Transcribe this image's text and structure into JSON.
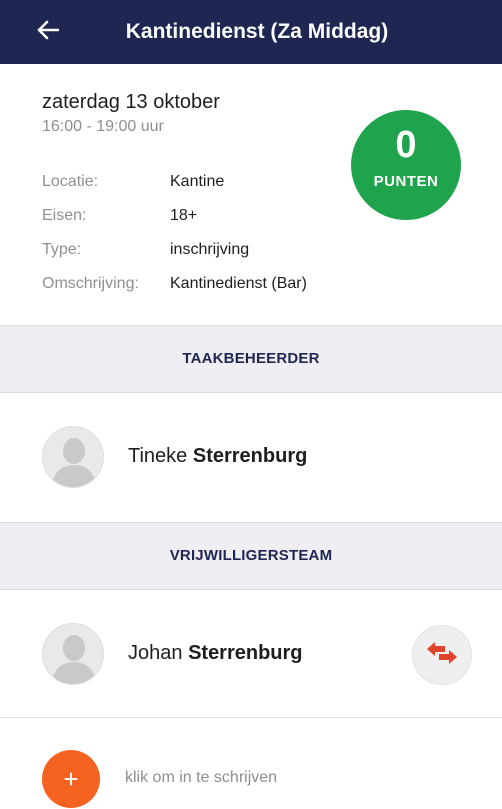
{
  "header": {
    "title": "Kantinedienst (Za Middag)",
    "back_icon": "arrow-left-icon"
  },
  "task": {
    "date": "zaterdag 13 oktober",
    "time": "16:00 - 19:00 uur",
    "details": [
      {
        "label": "Locatie:",
        "value": "Kantine"
      },
      {
        "label": "Eisen:",
        "value": "18+"
      },
      {
        "label": "Type:",
        "value": "inschrijving"
      },
      {
        "label": "Omschrijving:",
        "value": "Kantinedienst (Bar)"
      }
    ],
    "points": {
      "value": "0",
      "label": "PUNTEN",
      "color": "#1fa44d"
    }
  },
  "sections": {
    "manager": {
      "title": "TAAKBEHEERDER",
      "person": {
        "first_name": "Tineke",
        "last_name": "Sterrenburg"
      }
    },
    "team": {
      "title": "VRIJWILLIGERSTEAM",
      "person": {
        "first_name": "Johan",
        "last_name": "Sterrenburg",
        "action_icon": "swap-icon"
      }
    }
  },
  "signup": {
    "icon": "plus-icon",
    "plus_glyph": "+",
    "text": "klik om in te schrijven",
    "color": "#f5621f"
  },
  "colors": {
    "header_bg": "#1f2652",
    "section_text": "#1f2652",
    "swap_arrows": "#e2432d"
  }
}
